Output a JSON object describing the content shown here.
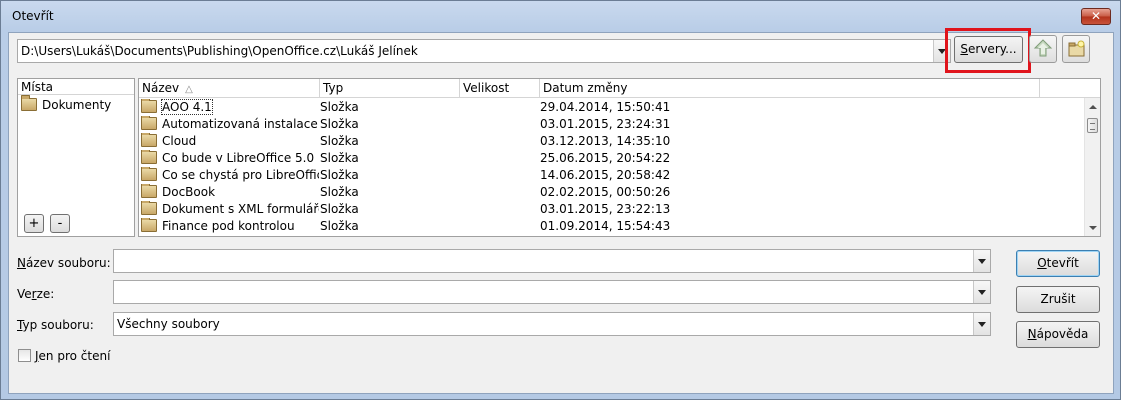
{
  "window": {
    "title": "Otevřít",
    "close_glyph": "✕"
  },
  "toolbar": {
    "path_value": "D:\\Users\\Lukáš\\Documents\\Publishing\\OpenOffice.cz\\Lukáš Jelínek",
    "servers_label_first": "S",
    "servers_label_rest": "ervery...",
    "up_icon": "folder-up-icon",
    "new_folder_icon": "new-folder-icon"
  },
  "places": {
    "header": "Místa",
    "items": [
      {
        "label": "Dokumenty",
        "icon": "folder-star-icon"
      }
    ],
    "add_label": "+",
    "remove_label": "-"
  },
  "files": {
    "columns": {
      "name": "Název",
      "type": "Typ",
      "size": "Velikost",
      "date": "Datum změny"
    },
    "sort_indicator": "△",
    "rows": [
      {
        "name": "AOO 4.1",
        "type": "Složka",
        "size": "",
        "date": "29.04.2014, 15:50:41"
      },
      {
        "name": "Automatizovaná instalace Li",
        "type": "Složka",
        "size": "",
        "date": "03.01.2015, 23:24:31"
      },
      {
        "name": "Cloud",
        "type": "Složka",
        "size": "",
        "date": "03.12.2013, 14:35:10"
      },
      {
        "name": "Co bude v LibreOffice 5.0",
        "type": "Složka",
        "size": "",
        "date": "25.06.2015, 20:54:22"
      },
      {
        "name": "Co se chystá pro LibreOffice",
        "type": "Složka",
        "size": "",
        "date": "14.06.2015, 20:58:42"
      },
      {
        "name": "DocBook",
        "type": "Složka",
        "size": "",
        "date": "02.02.2015, 00:50:26"
      },
      {
        "name": "Dokument s XML formulářer",
        "type": "Složka",
        "size": "",
        "date": "03.01.2015, 23:22:13"
      },
      {
        "name": "Finance pod kontrolou",
        "type": "Složka",
        "size": "",
        "date": "01.09.2014, 15:54:43"
      }
    ]
  },
  "form": {
    "filename_label_u": "N",
    "filename_label_rest": "ázev souboru:",
    "filename_value": "",
    "version_label_a": "Ve",
    "version_label_u": "r",
    "version_label_b": "ze:",
    "version_value": "",
    "filetype_label_u": "T",
    "filetype_label_rest": "yp souboru:",
    "filetype_value": "Všechny soubory",
    "readonly_label_u": "J",
    "readonly_label_rest": "en pro čtení",
    "readonly_checked": false
  },
  "buttons": {
    "open_u": "O",
    "open_rest": "tevřít",
    "cancel": "Zrušit",
    "help_u": "N",
    "help_rest": "ápověda"
  },
  "colors": {
    "highlight": "#e0141c",
    "default_button_border": "#3c7fb1"
  }
}
